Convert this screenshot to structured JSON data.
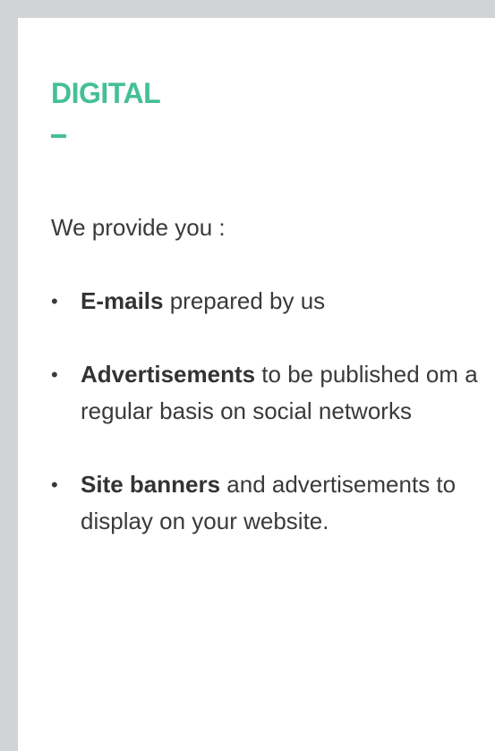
{
  "card": {
    "title": "DIGITAL",
    "intro": "We provide you :",
    "items": [
      {
        "bold": "E-mails",
        "text": " prepared by us"
      },
      {
        "bold": "Advertisements",
        "text": " to be published om a regular basis on social networks"
      },
      {
        "bold": "Site banners",
        "text": " and advertisements to display on your website."
      }
    ]
  },
  "colors": {
    "accent": "#45bf96",
    "frame": "#d2d3d4",
    "card_background": "#ffffff",
    "text": "#3a3a3a"
  }
}
